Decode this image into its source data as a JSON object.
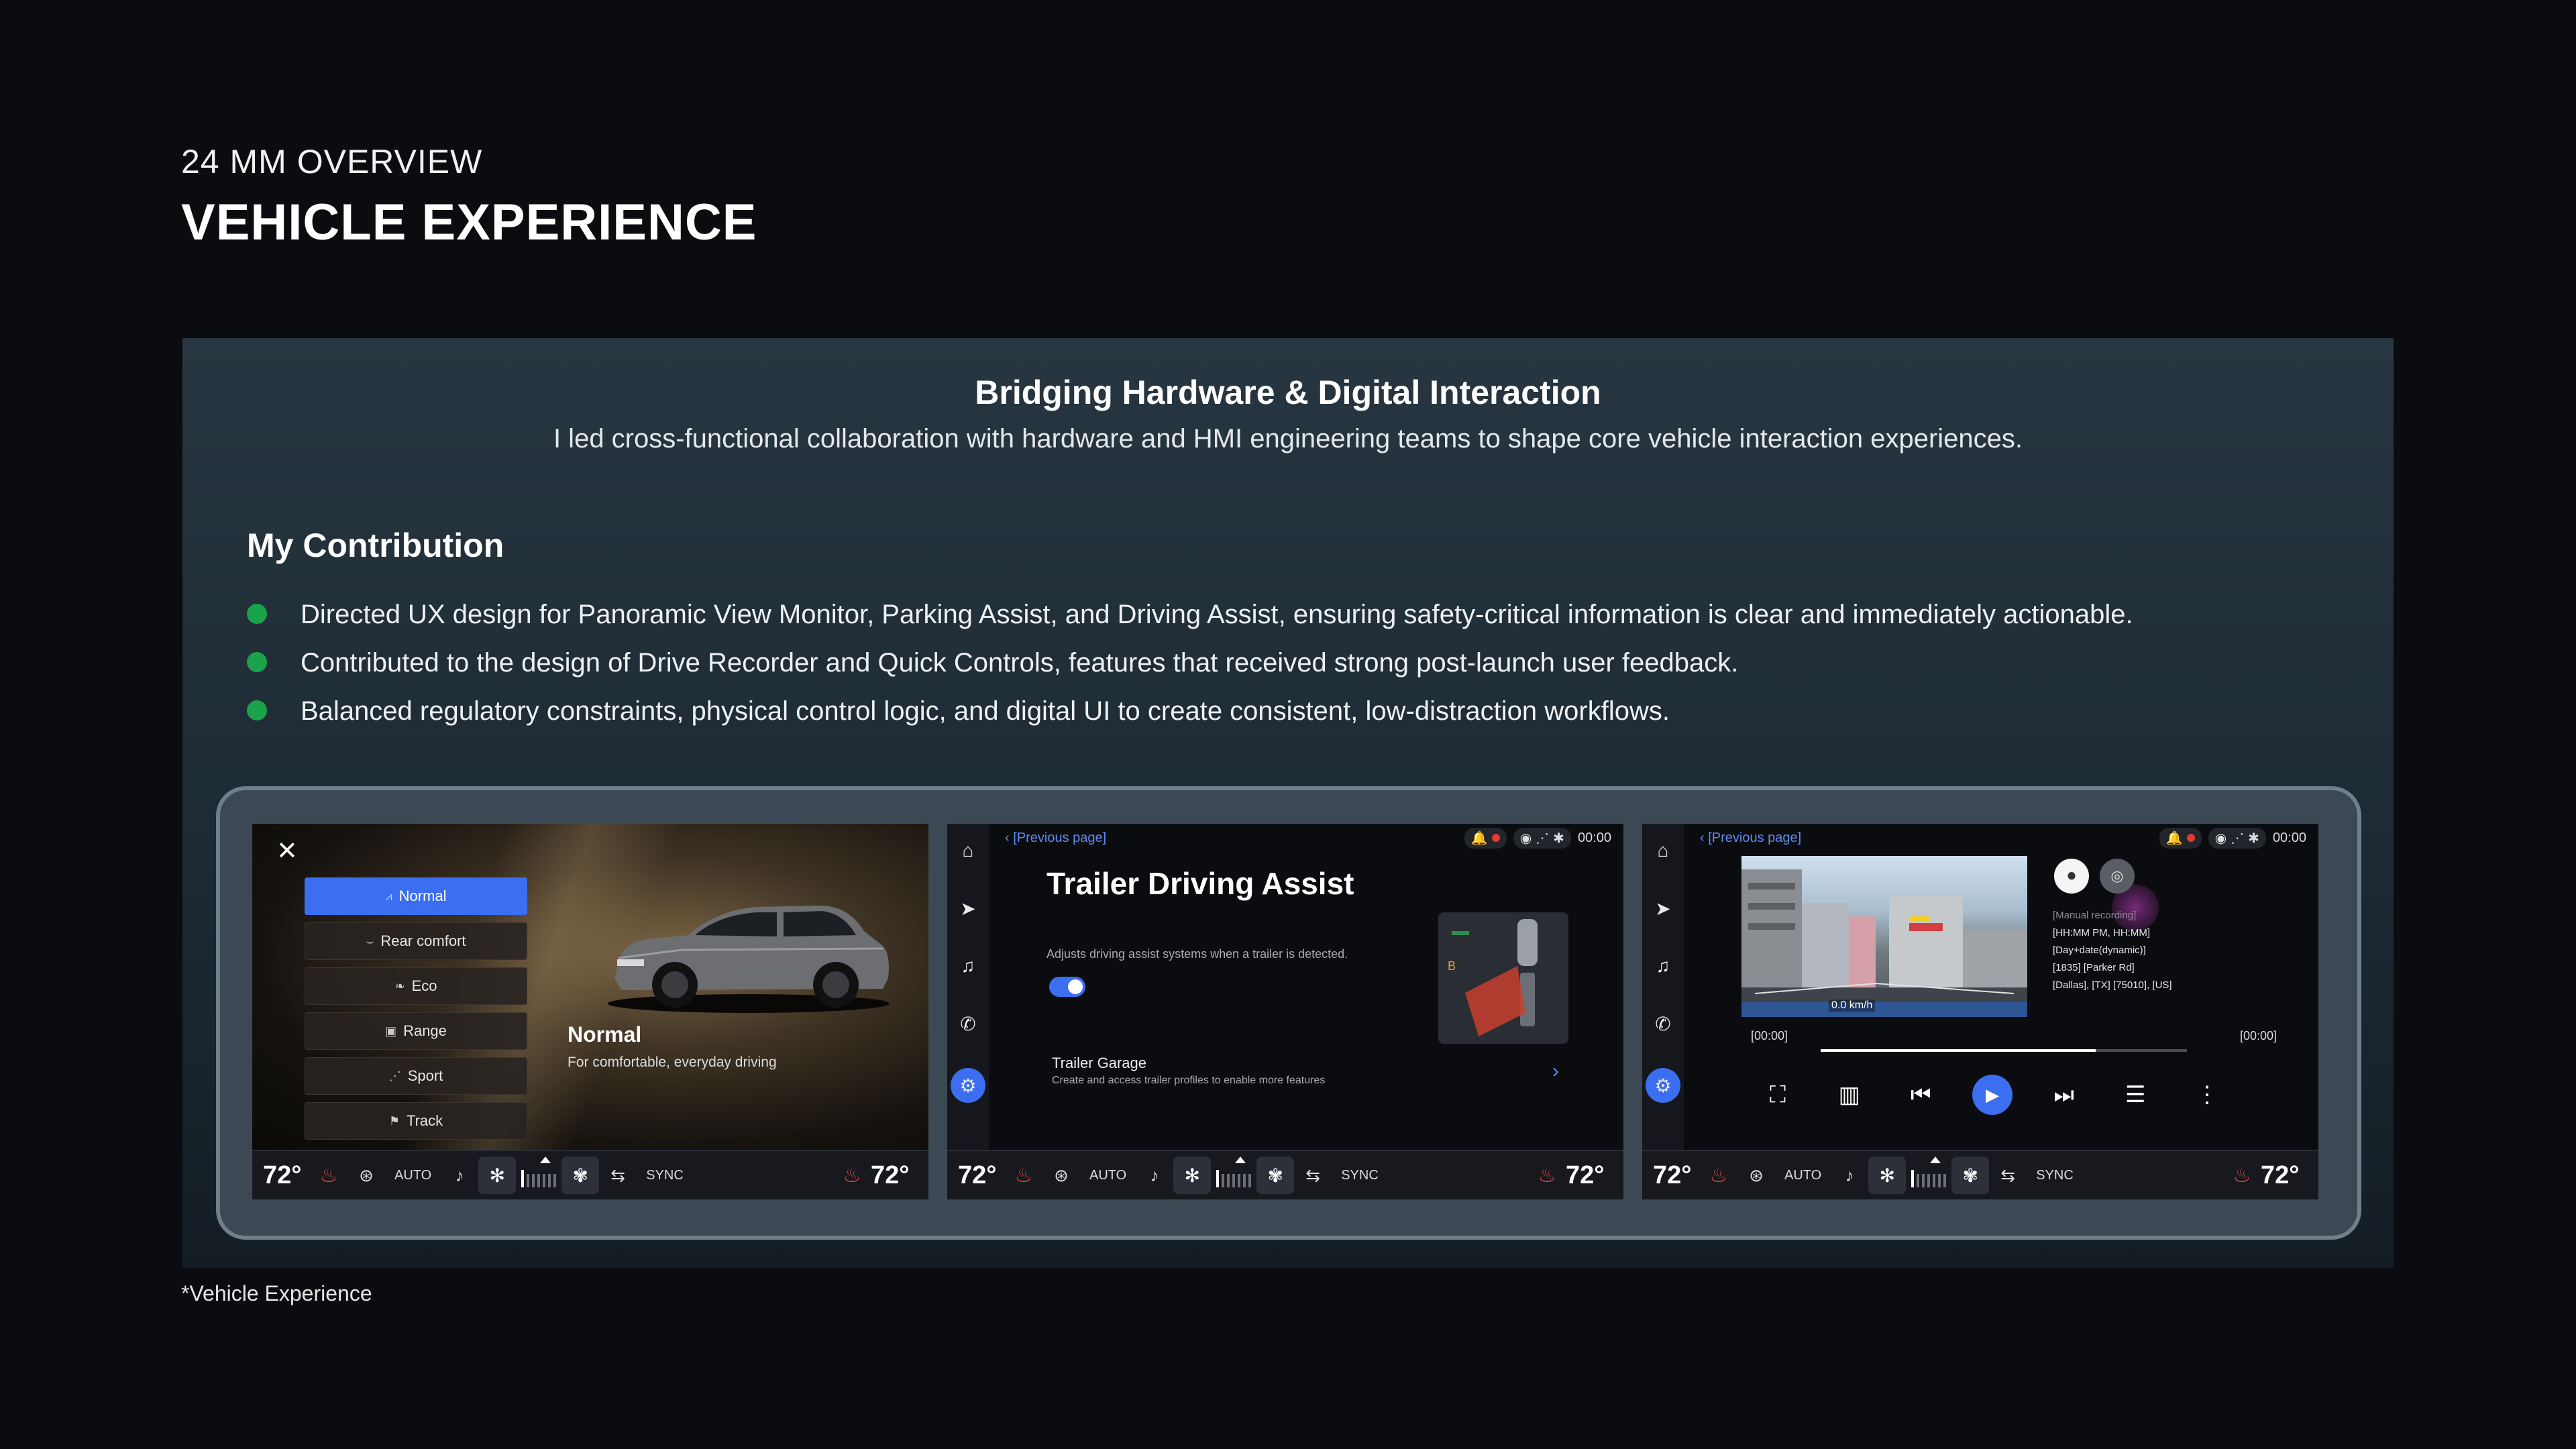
{
  "header": {
    "eyebrow": "24 MM OVERVIEW",
    "title": "VEHICLE EXPERIENCE"
  },
  "panel": {
    "heading": "Bridging Hardware & Digital Interaction",
    "subheading": "I led cross-functional collaboration with hardware and HMI engineering teams to shape core vehicle interaction experiences.",
    "contribution_heading": "My Contribution",
    "bullets": [
      "Directed UX design for Panoramic View Monitor, Parking Assist, and Driving Assist, ensuring safety-critical information is clear and immediately actionable.",
      "Contributed to the design of Drive Recorder and Quick Controls, features that received strong post-launch user feedback.",
      "Balanced regulatory constraints, physical control logic, and digital UI to create consistent, low-distraction workflows."
    ],
    "bullet_color": "#1aa34a"
  },
  "footnote": "*Vehicle Experience",
  "climate": {
    "temp_left": "72°",
    "temp_right": "72°",
    "auto": "AUTO",
    "sync": "SYNC",
    "fan_level": 0.3
  },
  "drive_modes": {
    "items": [
      {
        "label": "Normal",
        "icon": "normal-mode-icon",
        "active": true
      },
      {
        "label": "Rear comfort",
        "icon": "rear-comfort-icon"
      },
      {
        "label": "Eco",
        "icon": "leaf-icon"
      },
      {
        "label": "Range",
        "icon": "battery-icon"
      },
      {
        "label": "Sport",
        "icon": "sport-icon"
      },
      {
        "label": "Track",
        "icon": "flag-icon"
      }
    ],
    "selected_title": "Normal",
    "selected_desc": "For comfortable, everyday driving"
  },
  "status_bar": {
    "time": "00:00"
  },
  "trailer": {
    "prev": "[Previous page]",
    "title": "Trailer Driving Assist",
    "desc": "Adjusts driving assist systems when a trailer is detected.",
    "toggle_on": true,
    "garage_title": "Trailer Garage",
    "garage_desc": "Create and access trailer profiles to enable more features"
  },
  "recorder": {
    "prev": "[Previous page]",
    "speed": "0.0 km/h",
    "info": {
      "label": "[Manual recording]",
      "time": "[HH:MM PM, HH:MM]",
      "date": "[Day+date(dynamic)]",
      "street": "[1835] [Parker Rd]",
      "city": "[Dallas], [TX] [75010], [US]"
    },
    "time_start": "[00:00]",
    "time_end": "[00:00]",
    "progress": 0.75
  },
  "accent": "#3b6ef0"
}
